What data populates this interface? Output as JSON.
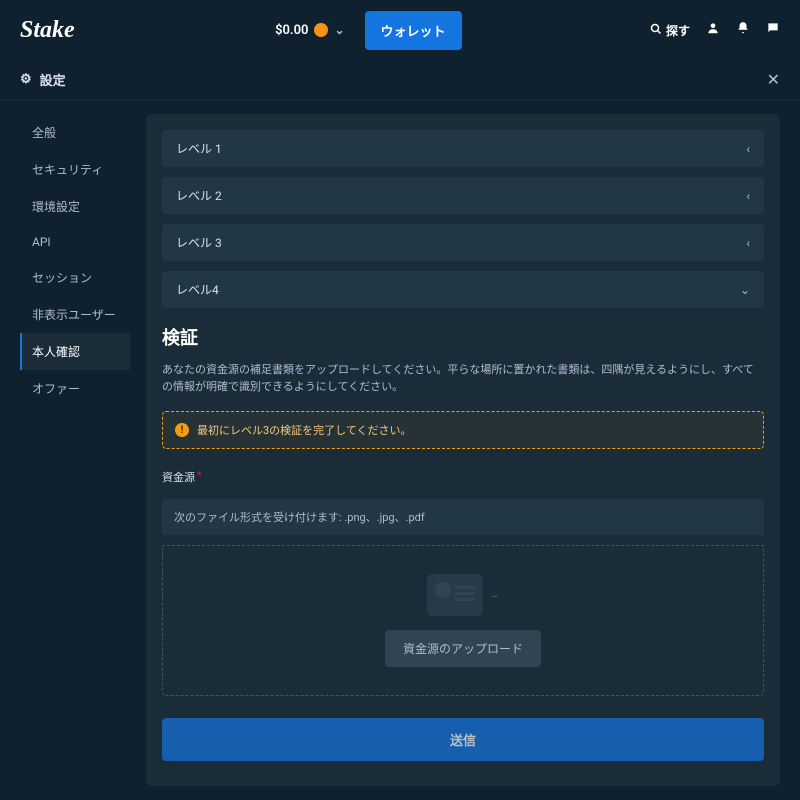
{
  "header": {
    "logo": "Stake",
    "balance": "$0.00",
    "wallet_label": "ウォレット",
    "search_label": "探す"
  },
  "settings": {
    "title": "設定"
  },
  "sidebar": {
    "items": [
      {
        "label": "全般"
      },
      {
        "label": "セキュリティ"
      },
      {
        "label": "環境設定"
      },
      {
        "label": "API"
      },
      {
        "label": "セッション"
      },
      {
        "label": "非表示ユーザー"
      },
      {
        "label": "本人確認"
      },
      {
        "label": "オファー"
      }
    ]
  },
  "levels": [
    {
      "label": "レベル 1",
      "expanded": false
    },
    {
      "label": "レベル 2",
      "expanded": false
    },
    {
      "label": "レベル 3",
      "expanded": false
    },
    {
      "label": "レベル4",
      "expanded": true
    }
  ],
  "verify": {
    "title": "検証",
    "desc": "あなたの資金源の補足書類をアップロードしてください。平らな場所に置かれた書類は、四隅が見えるようにし、すべての情報が明確で識別できるようにしてください。",
    "alert": "最初にレベル3の検証を完了してください。",
    "field_label": "資金源",
    "file_hint": "次のファイル形式を受け付けます: .png、.jpg、.pdf",
    "upload_btn": "資金源のアップロード",
    "submit_btn": "送信"
  }
}
